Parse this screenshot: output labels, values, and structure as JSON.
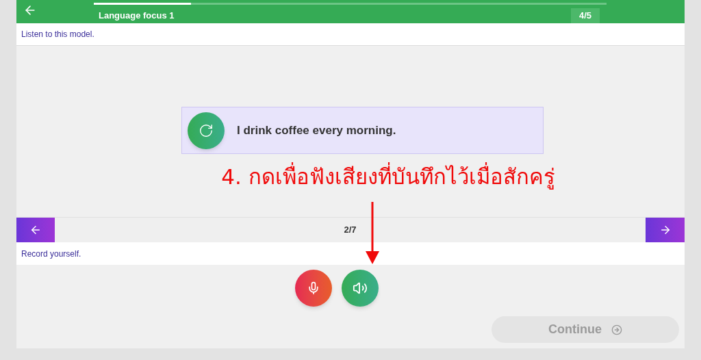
{
  "header": {
    "title": "Language focus 1",
    "progress": {
      "level": 0.19
    },
    "counter": "4/5"
  },
  "prompt": "Listen to this model.",
  "sentence_card": {
    "text": "I drink coffee every morning."
  },
  "annotation": "4. กดเพื่อฟังเสียงที่บันทึกไว้เมื่อสักครู่",
  "pager": {
    "position": "2/7"
  },
  "instruction": "Record yourself.",
  "continue_button": {
    "label": "Continue",
    "disabled": true
  }
}
